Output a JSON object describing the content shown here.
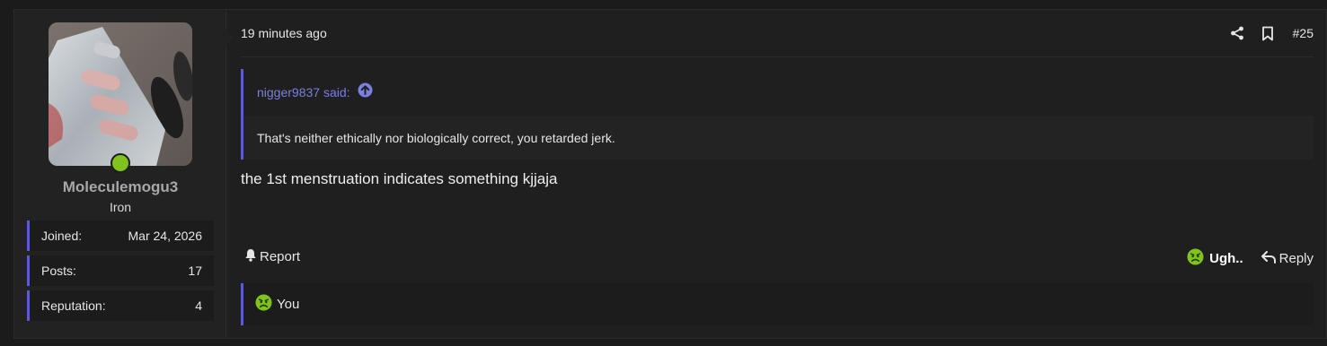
{
  "user": {
    "username": "Moleculemogu3",
    "user_title": "Iron",
    "online": true,
    "stats": [
      {
        "label": "Joined:",
        "value": "Mar 24, 2026"
      },
      {
        "label": "Posts:",
        "value": "17"
      },
      {
        "label": "Reputation:",
        "value": "4"
      }
    ]
  },
  "post": {
    "timestamp": "19 minutes ago",
    "number": "#25",
    "quote": {
      "author_line": "nigger9837 said:",
      "text": "That's neither ethically nor biologically correct, you retarded jerk."
    },
    "message": "the 1st menstruation indicates something kjjaja"
  },
  "actions": {
    "report_label": "Report",
    "reaction_label": "Ugh..",
    "reply_label": "Reply"
  },
  "reactions": {
    "by": "You"
  },
  "colors": {
    "accent": "#5a5ec8",
    "link": "#7a7fe0",
    "online": "#7fc31c",
    "reaction": "#7fc31c"
  },
  "icons": [
    "share-icon",
    "bookmark-icon",
    "arrow-up-circle-icon",
    "bell-icon",
    "ugh-emoji-icon",
    "reply-arrow-icon"
  ]
}
